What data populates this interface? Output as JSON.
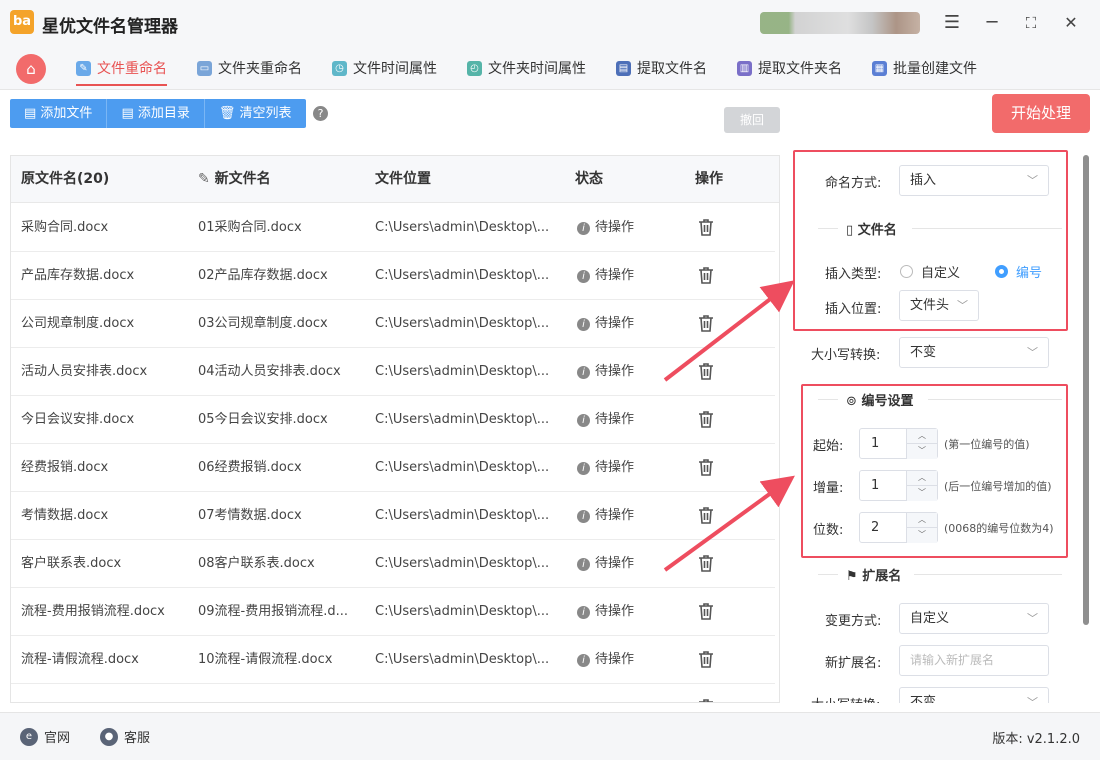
{
  "app": {
    "title": "星优文件名管理器",
    "logo_text": "ba"
  },
  "window": {
    "settings_icon": "☰",
    "min_icon": "─",
    "max_icon": "⛶",
    "close_icon": "✕"
  },
  "tabs": [
    {
      "label": "文件重命名",
      "active": true
    },
    {
      "label": "文件夹重命名"
    },
    {
      "label": "文件时间属性"
    },
    {
      "label": "文件夹时间属性"
    },
    {
      "label": "提取文件名"
    },
    {
      "label": "提取文件夹名"
    },
    {
      "label": "批量创建文件"
    }
  ],
  "toolbar": {
    "add_file": "添加文件",
    "add_dir": "添加目录",
    "clear_list": "清空列表",
    "help": "?",
    "undo": "撤回",
    "start": "开始处理"
  },
  "table": {
    "headers": {
      "original": "原文件名(20)",
      "new": "新文件名",
      "location": "文件位置",
      "status": "状态",
      "action": "操作"
    },
    "rows": [
      {
        "orig": "采购合同.docx",
        "new": "01采购合同.docx",
        "loc": "C:\\Users\\admin\\Desktop\\...",
        "status": "待操作"
      },
      {
        "orig": "产品库存数据.docx",
        "new": "02产品库存数据.docx",
        "loc": "C:\\Users\\admin\\Desktop\\...",
        "status": "待操作"
      },
      {
        "orig": "公司规章制度.docx",
        "new": "03公司规章制度.docx",
        "loc": "C:\\Users\\admin\\Desktop\\...",
        "status": "待操作"
      },
      {
        "orig": "活动人员安排表.docx",
        "new": "04活动人员安排表.docx",
        "loc": "C:\\Users\\admin\\Desktop\\...",
        "status": "待操作"
      },
      {
        "orig": "今日会议安排.docx",
        "new": "05今日会议安排.docx",
        "loc": "C:\\Users\\admin\\Desktop\\...",
        "status": "待操作"
      },
      {
        "orig": "经费报销.docx",
        "new": "06经费报销.docx",
        "loc": "C:\\Users\\admin\\Desktop\\...",
        "status": "待操作"
      },
      {
        "orig": "考情数据.docx",
        "new": "07考情数据.docx",
        "loc": "C:\\Users\\admin\\Desktop\\...",
        "status": "待操作"
      },
      {
        "orig": "客户联系表.docx",
        "new": "08客户联系表.docx",
        "loc": "C:\\Users\\admin\\Desktop\\...",
        "status": "待操作"
      },
      {
        "orig": "流程-费用报销流程.docx",
        "new": "09流程-费用报销流程.d...",
        "loc": "C:\\Users\\admin\\Desktop\\...",
        "status": "待操作"
      },
      {
        "orig": "流程-请假流程.docx",
        "new": "10流程-请假流程.docx",
        "loc": "C:\\Users\\admin\\Desktop\\...",
        "status": "待操作"
      }
    ]
  },
  "panel": {
    "naming_label": "命名方式:",
    "naming_value": "插入",
    "filename_section": "文件名",
    "insert_type_label": "插入类型:",
    "insert_type_options": [
      "自定义",
      "编号"
    ],
    "insert_type_selected": "编号",
    "insert_pos_label": "插入位置:",
    "insert_pos_value": "文件头",
    "case_label": "大小写转换:",
    "case_value": "不变",
    "numbering_section": "编号设置",
    "start_label": "起始:",
    "start_value": "1",
    "start_hint": "(第一位编号的值)",
    "step_label": "增量:",
    "step_value": "1",
    "step_hint": "(后一位编号增加的值)",
    "digits_label": "位数:",
    "digits_value": "2",
    "digits_hint": "(0068的编号位数为4)",
    "ext_section": "扩展名",
    "ext_change_label": "变更方式:",
    "ext_change_value": "自定义",
    "new_ext_label": "新扩展名:",
    "new_ext_placeholder": "请输入新扩展名",
    "ext_case_label": "大小写转换:",
    "ext_case_value": "不变"
  },
  "footer": {
    "site": "官网",
    "support": "客服",
    "version": "版本:  v2.1.2.0"
  },
  "colors": {
    "accent": "#e85353",
    "primary": "#4d9cf0",
    "highlight_box": "#ee4d5f"
  }
}
